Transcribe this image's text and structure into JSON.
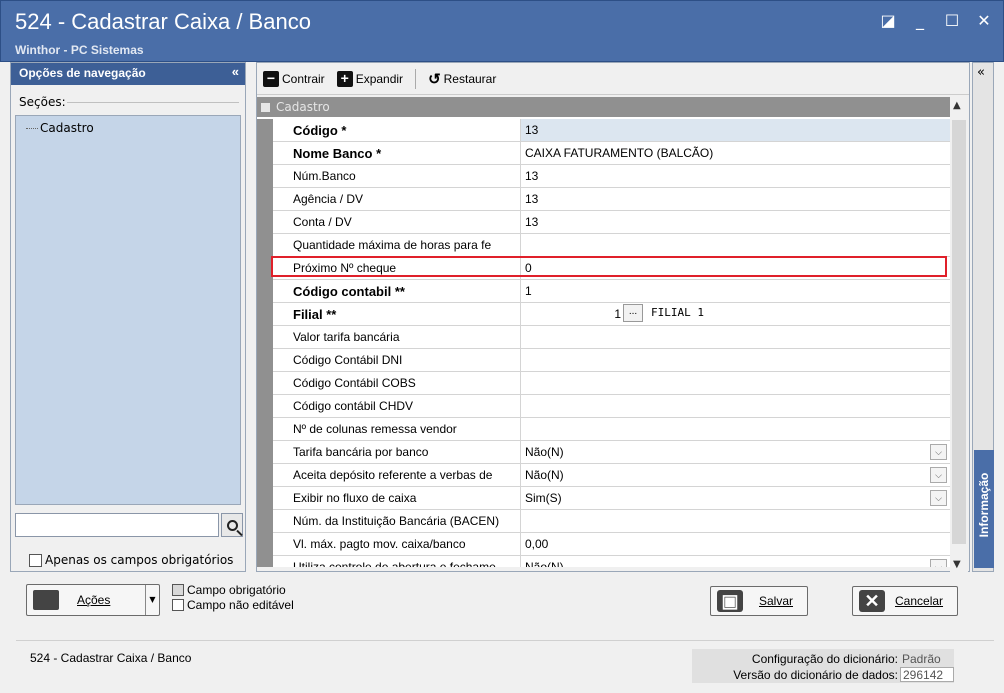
{
  "window": {
    "title": "524 - Cadastrar Caixa / Banco",
    "subtitle": "Winthor - PC Sistemas",
    "buttons": [
      "restore",
      "minimize",
      "maximize",
      "close"
    ]
  },
  "nav": {
    "header": "Opções de navegação",
    "sections_label": "Seções:",
    "tree_items": [
      "Cadastro"
    ],
    "search_value": "",
    "required_only_label": "Apenas os campos obrigatórios"
  },
  "toolbar": {
    "collapse_label": "Contrair",
    "expand_label": "Expandir",
    "restore_label": "Restaurar"
  },
  "grid": {
    "category": "Cadastro",
    "rows": [
      {
        "label": "Código *",
        "value": "13",
        "bold": true,
        "selected": true
      },
      {
        "label": "Nome Banco *",
        "value": "CAIXA FATURAMENTO (BALCÃO)",
        "bold": true
      },
      {
        "label": "Núm.Banco",
        "value": "13"
      },
      {
        "label": "Agência / DV",
        "value": "13"
      },
      {
        "label": "Conta / DV",
        "value": "13"
      },
      {
        "label": "Quantidade máxima de horas para fe",
        "value": ""
      },
      {
        "label": "Próximo Nº cheque",
        "value": "0",
        "highlighted": true
      },
      {
        "label": "Código contabil **",
        "value": "1",
        "bold": true
      },
      {
        "label": "Filial **",
        "value": "1",
        "lookup_text": "FILIAL 1",
        "bold": true
      },
      {
        "label": "Valor tarifa bancária",
        "value": ""
      },
      {
        "label": "Código Contábil DNI",
        "value": ""
      },
      {
        "label": "Código Contábil COBS",
        "value": ""
      },
      {
        "label": "Código contábil CHDV",
        "value": ""
      },
      {
        "label": "Nº de colunas remessa vendor",
        "value": ""
      },
      {
        "label": "Tarifa bancária por banco",
        "value": "Não(N)",
        "dropdown": true
      },
      {
        "label": "Aceita depósito referente a verbas de",
        "value": "Não(N)",
        "dropdown": true
      },
      {
        "label": "Exibir no fluxo de caixa",
        "value": "Sim(S)",
        "dropdown": true
      },
      {
        "label": "Núm. da Instituição Bancária (BACEN)",
        "value": ""
      },
      {
        "label": "Vl. máx. pagto mov. caixa/banco",
        "value": "0,00"
      },
      {
        "label": "Utiliza controle de abertura e fechame",
        "value": "Não(N)",
        "dropdown": true
      }
    ]
  },
  "side_tab": "Informação",
  "footer": {
    "actions_label": "Ações",
    "legend_required": "Campo obrigatório",
    "legend_readonly": "Campo não editável",
    "save_label": "Salvar",
    "cancel_label": "Cancelar"
  },
  "status": {
    "left": "524 - Cadastrar Caixa / Banco",
    "dict_config_label": "Configuração do dicionário:",
    "dict_config_value": "Padrão",
    "dict_version_label": "Versão do dicionário de dados:",
    "dict_version_value": "296142"
  },
  "colors": {
    "title_bar": "#4a6ea8",
    "tree_bg": "#c5d5e8",
    "highlight_box": "#e0202a",
    "category_bar": "#909090"
  }
}
